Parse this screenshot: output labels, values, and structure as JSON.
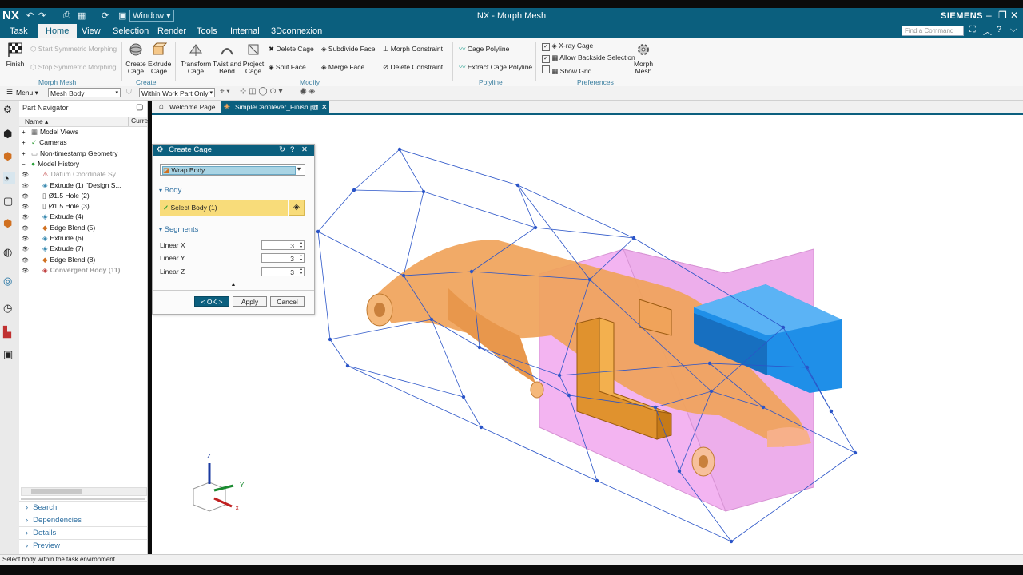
{
  "titlebar": {
    "app_logo": "NX",
    "window_menu": "Window",
    "title": "NX - Morph Mesh",
    "brand": "SIEMENS"
  },
  "menu_tabs": [
    "Task",
    "Home",
    "View",
    "Selection",
    "Render",
    "Tools",
    "Internal",
    "3Dconnexion"
  ],
  "active_tab": "Home",
  "command_finder_placeholder": "Find a Command",
  "ribbon": {
    "finish": "Finish",
    "start_symmetric": "Start Symmetric Morphing",
    "stop_symmetric": "Stop Symmetric Morphing",
    "create_cage": "Create Cage",
    "extrude_cage": "Extrude Cage",
    "transform_cage": "Transform Cage",
    "twist_and_bend": "Twist and Bend",
    "project_cage": "Project Cage",
    "delete_cage": "Delete Cage",
    "split_face": "Split Face",
    "subdivide_face": "Subdivide Face",
    "merge_face": "Merge Face",
    "morph_constraint": "Morph Constraint",
    "delete_constraint": "Delete Constraint",
    "cage_polyline": "Cage Polyline",
    "extract_cage_polyline": "Extract Cage Polyline",
    "xray_cage": "X-ray Cage",
    "allow_backside": "Allow Backside Selection",
    "show_grid": "Show Grid",
    "morph_mesh": "Morph Mesh",
    "groups": {
      "morph_mesh": "Morph Mesh",
      "create": "Create",
      "modify": "Modify",
      "polyline": "Polyline",
      "preferences": "Preferences"
    }
  },
  "toolbar": {
    "menu": "Menu",
    "filter": "Mesh Body",
    "scope": "Within Work Part Only"
  },
  "navigator": {
    "title": "Part Navigator",
    "col_name": "Name",
    "col_current": "Curre",
    "items": [
      {
        "label": "Model Views"
      },
      {
        "label": "Cameras"
      },
      {
        "label": "Non-timestamp Geometry"
      },
      {
        "label": "Model History"
      },
      {
        "label": "Datum Coordinate Sy..."
      },
      {
        "label": "Extrude (1) \"Design S..."
      },
      {
        "label": "Ø1.5 Hole (2)"
      },
      {
        "label": "Ø1.5 Hole (3)"
      },
      {
        "label": "Extrude (4)"
      },
      {
        "label": "Edge Blend (5)"
      },
      {
        "label": "Extrude (6)"
      },
      {
        "label": "Extrude (7)"
      },
      {
        "label": "Edge Blend (8)"
      },
      {
        "label": "Convergent Body (11)"
      }
    ],
    "bottom_panels": [
      "Search",
      "Dependencies",
      "Details",
      "Preview"
    ]
  },
  "doc_tabs": [
    "Welcome Page",
    "SimpleCantilever_Finish.prt"
  ],
  "dialog": {
    "title": "Create Cage",
    "type_value": "Wrap Body",
    "body_section": "Body",
    "select_body": "Select Body (1)",
    "segments_section": "Segments",
    "linear_x_label": "Linear X",
    "linear_x": "3",
    "linear_y_label": "Linear Y",
    "linear_y": "3",
    "linear_z_label": "Linear Z",
    "linear_z": "3",
    "ok": "< OK >",
    "apply": "Apply",
    "cancel": "Cancel"
  },
  "triad": {
    "z": "Z",
    "y": "Y",
    "x": "X"
  },
  "status_text": "Select body within the task environment.",
  "colors": {
    "header": "#0b5f7e",
    "cage_line": "#2b55c8",
    "part_orange": "#f0a35a",
    "box_pink": "#f2a3ef",
    "block_blue": "#1f8fe8",
    "select_yellow": "#f8dc7a"
  }
}
